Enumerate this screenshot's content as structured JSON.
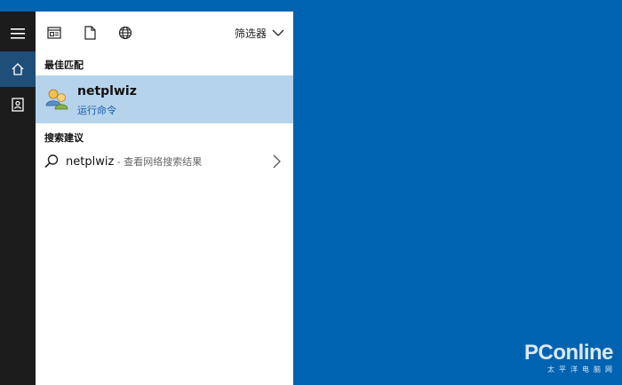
{
  "rail": {
    "menu_icon": "hamburger-menu-icon",
    "home_icon": "home-icon",
    "notebook_icon": "notebook-icon"
  },
  "filterbar": {
    "icons": [
      "apps-filter-icon",
      "documents-filter-icon",
      "web-filter-icon"
    ],
    "filter_label": "筛选器"
  },
  "best_match": {
    "section_label": "最佳匹配",
    "title": "netplwiz",
    "subtitle": "运行命令",
    "icon": "user-accounts-icon"
  },
  "suggestions": {
    "section_label": "搜索建议",
    "items": [
      {
        "query": "netplwiz",
        "desc": " - 查看网络搜索结果"
      }
    ]
  },
  "watermark": {
    "logo": "PConline",
    "subtitle": "太平洋电脑网"
  },
  "colors": {
    "desktop": "#0063b1",
    "rail": "#1c1c1c",
    "rail_active": "#1f4e79",
    "panel": "#ffffff",
    "selected": "#b6d3ec",
    "subtitle_link": "#1a5ea8"
  }
}
